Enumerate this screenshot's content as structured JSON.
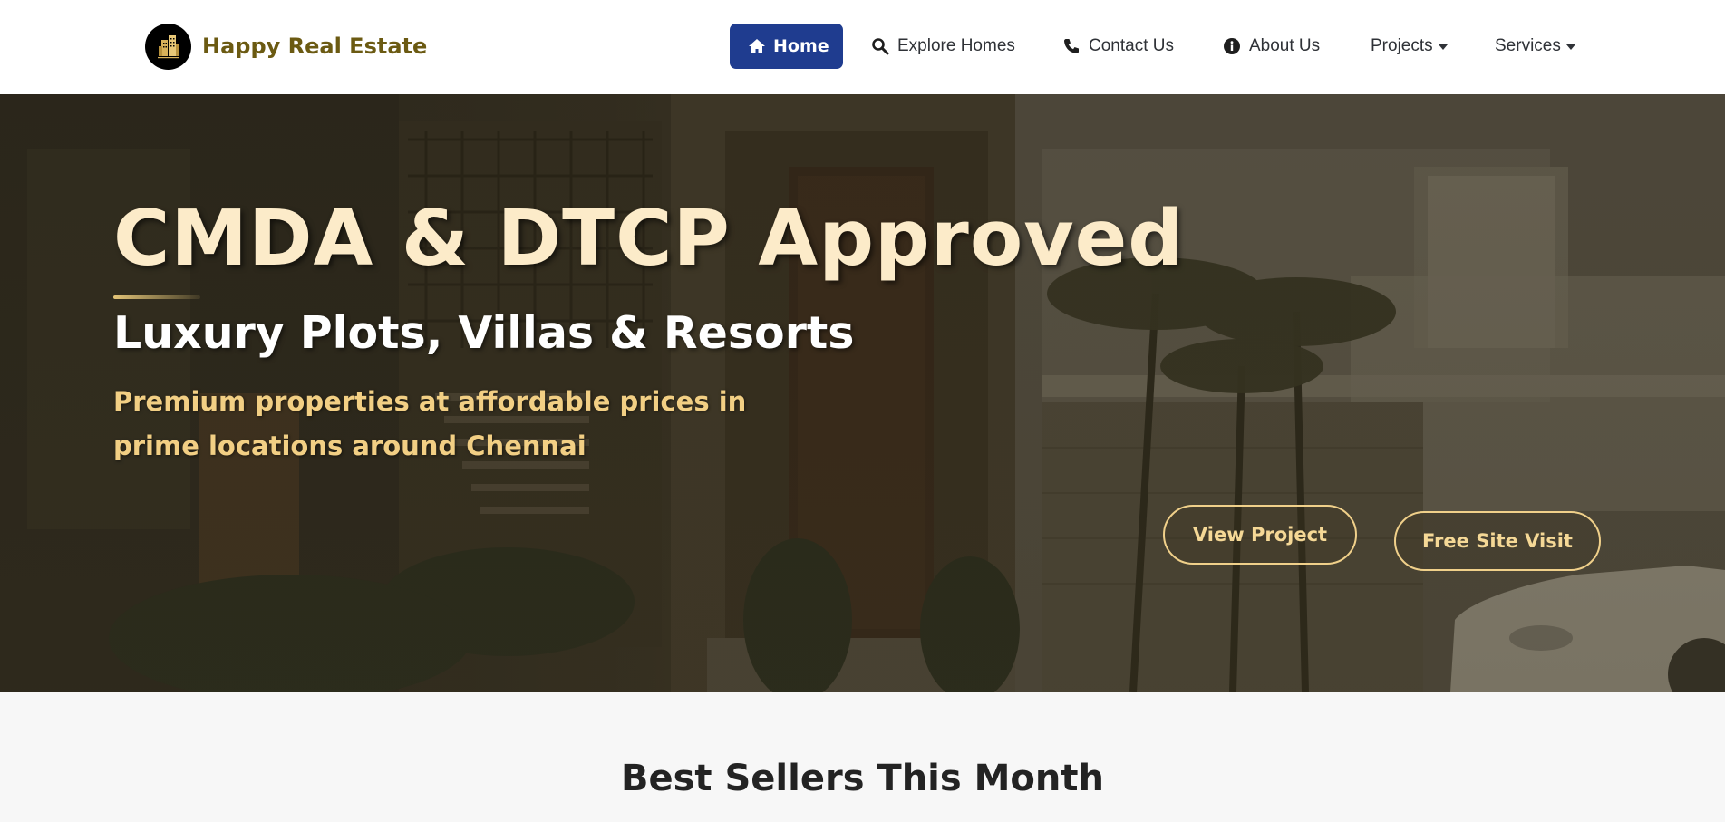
{
  "brand": {
    "name": "Happy Real Estate",
    "logo_icon": "building-logo-icon"
  },
  "nav": {
    "items": [
      {
        "label": "Home",
        "icon": "home-icon",
        "active": true
      },
      {
        "label": "Explore Homes",
        "icon": "search-icon"
      },
      {
        "label": "Contact Us",
        "icon": "phone-icon"
      },
      {
        "label": "About Us",
        "icon": "info-icon"
      },
      {
        "label": "Projects",
        "dropdown": true
      },
      {
        "label": "Services",
        "dropdown": true
      }
    ]
  },
  "hero": {
    "title": "CMDA & DTCP Approved",
    "subtitle": "Luxury Plots, Villas & Resorts",
    "description": "Premium properties at affordable prices in prime locations around Chennai",
    "buttons": {
      "view_project": "View Project",
      "free_site_visit": "Free Site Visit"
    }
  },
  "best_sellers": {
    "title": "Best Sellers This Month"
  },
  "colors": {
    "brand_text": "#6b5a12",
    "nav_active_bg": "#1f3c8f",
    "hero_title": "#fcebc9",
    "hero_desc": "#f2cf84",
    "button_border": "#f0d08a"
  }
}
